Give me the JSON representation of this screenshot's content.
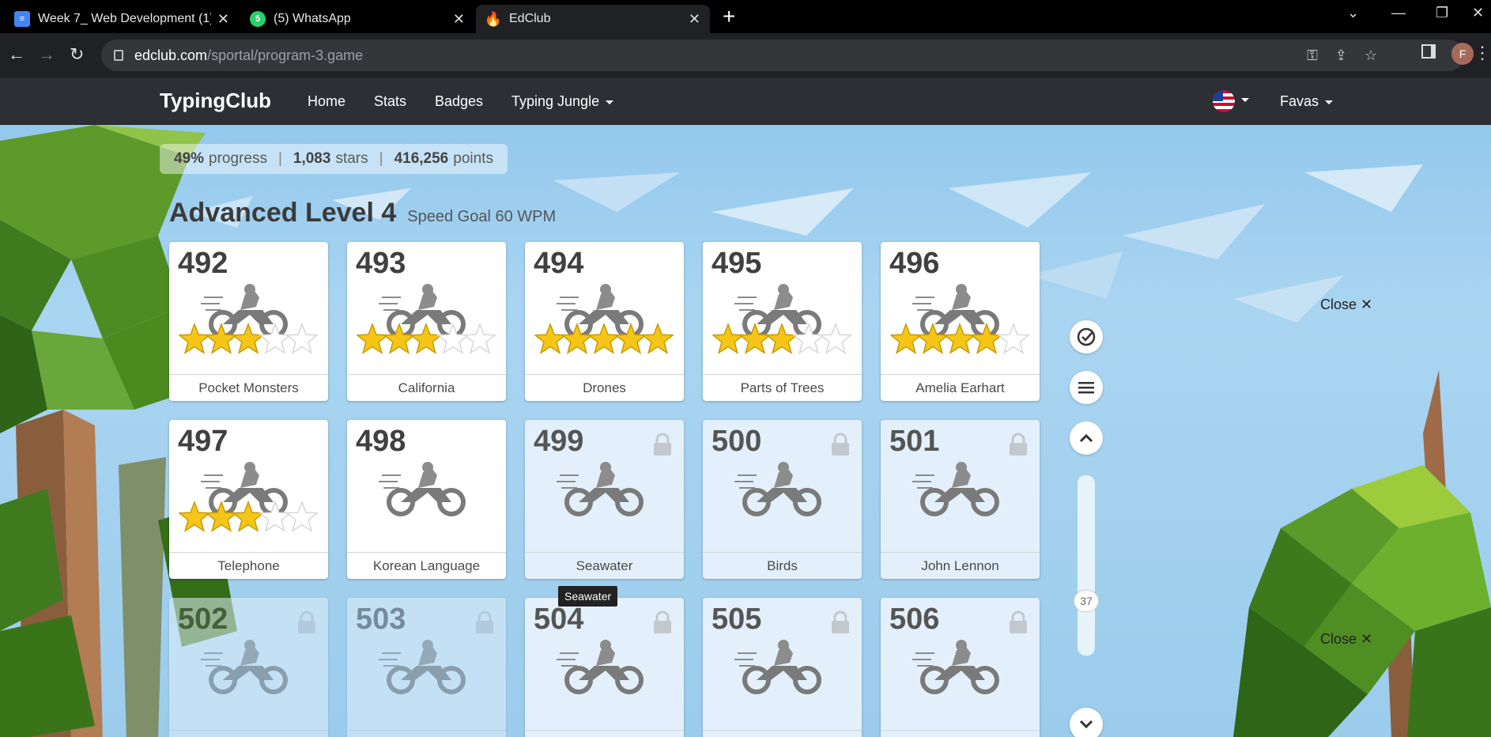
{
  "browser": {
    "tabs": [
      {
        "title": "Week 7_ Web Development (1).c",
        "icon": "google-docs-icon"
      },
      {
        "title": "(5) WhatsApp",
        "icon": "whatsapp-icon",
        "badge": "5"
      },
      {
        "title": "EdClub",
        "icon": "edclub-icon"
      }
    ],
    "url_host": "edclub.com",
    "url_path": "/sportal/program-3.game",
    "profile_initial": "F"
  },
  "site": {
    "logo": "TypingClub",
    "nav": [
      "Home",
      "Stats",
      "Badges",
      "Typing Jungle"
    ],
    "user": "Favas"
  },
  "stats": {
    "progress_value": "49%",
    "progress_label": "progress",
    "stars_value": "1,083",
    "stars_label": "stars",
    "points_value": "416,256",
    "points_label": "points"
  },
  "level": {
    "name": "Advanced Level 4",
    "goal": "Speed Goal 60 WPM"
  },
  "lessons": [
    {
      "num": "492",
      "name": "Pocket Monsters",
      "stars": 3,
      "locked": false
    },
    {
      "num": "493",
      "name": "California",
      "stars": 3,
      "locked": false
    },
    {
      "num": "494",
      "name": "Drones",
      "stars": 5,
      "locked": false
    },
    {
      "num": "495",
      "name": "Parts of Trees",
      "stars": 3,
      "locked": false
    },
    {
      "num": "496",
      "name": "Amelia Earhart",
      "stars": 4,
      "locked": false
    },
    {
      "num": "497",
      "name": "Telephone",
      "stars": 3,
      "locked": false
    },
    {
      "num": "498",
      "name": "Korean Language",
      "stars": 0,
      "locked": false
    },
    {
      "num": "499",
      "name": "Seawater",
      "stars": 0,
      "locked": true
    },
    {
      "num": "500",
      "name": "Birds",
      "stars": 0,
      "locked": true
    },
    {
      "num": "501",
      "name": "John Lennon",
      "stars": 0,
      "locked": true
    },
    {
      "num": "502",
      "name": "",
      "stars": 0,
      "locked": true
    },
    {
      "num": "503",
      "name": "",
      "stars": 0,
      "locked": true
    },
    {
      "num": "504",
      "name": "",
      "stars": 0,
      "locked": true
    },
    {
      "num": "505",
      "name": "",
      "stars": 0,
      "locked": true
    },
    {
      "num": "506",
      "name": "",
      "stars": 0,
      "locked": true
    }
  ],
  "tooltip": "Seawater",
  "slider_value": "37",
  "close_label": "Close"
}
